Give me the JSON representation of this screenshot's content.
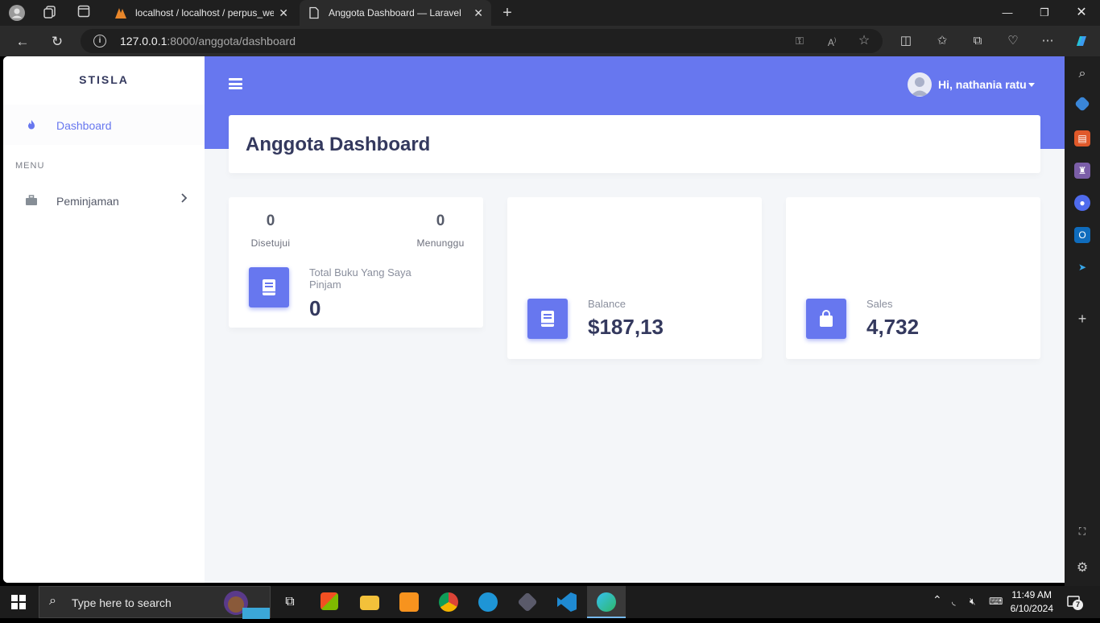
{
  "browser": {
    "tabs": [
      {
        "title": "localhost / localhost / perpus_we",
        "active": false
      },
      {
        "title": "Anggota Dashboard — Laravel",
        "active": true
      }
    ],
    "url_host": "127.0.0.1",
    "url_rest": ":8000/anggota/dashboard"
  },
  "app": {
    "brand": "STISLA",
    "sidebar": {
      "items": [
        {
          "label": "Dashboard",
          "icon": "fire-icon",
          "active": true
        },
        {
          "label": "Peminjaman",
          "icon": "briefcase-icon",
          "has_submenu": true
        }
      ],
      "menu_header": "MENU"
    },
    "navbar": {
      "user_greeting": "Hi, nathania ratu"
    },
    "page_title": "Anggota Dashboard",
    "cards": {
      "peminjaman": {
        "stats": [
          {
            "value": "0",
            "label": "Disetujui"
          },
          {
            "value": "0",
            "label": "Menunggu"
          }
        ],
        "label": "Total Buku Yang Saya Pinjam",
        "value": "0",
        "icon": "book-icon"
      },
      "balance": {
        "label": "Balance",
        "value": "$187,13",
        "icon": "book-icon"
      },
      "sales": {
        "label": "Sales",
        "value": "4,732",
        "icon": "shopping-bag-icon"
      }
    },
    "accent_color": "#6777ef"
  },
  "taskbar": {
    "search_placeholder": "Type here to search",
    "time": "11:49 AM",
    "date": "6/10/2024",
    "notification_count": "7"
  }
}
